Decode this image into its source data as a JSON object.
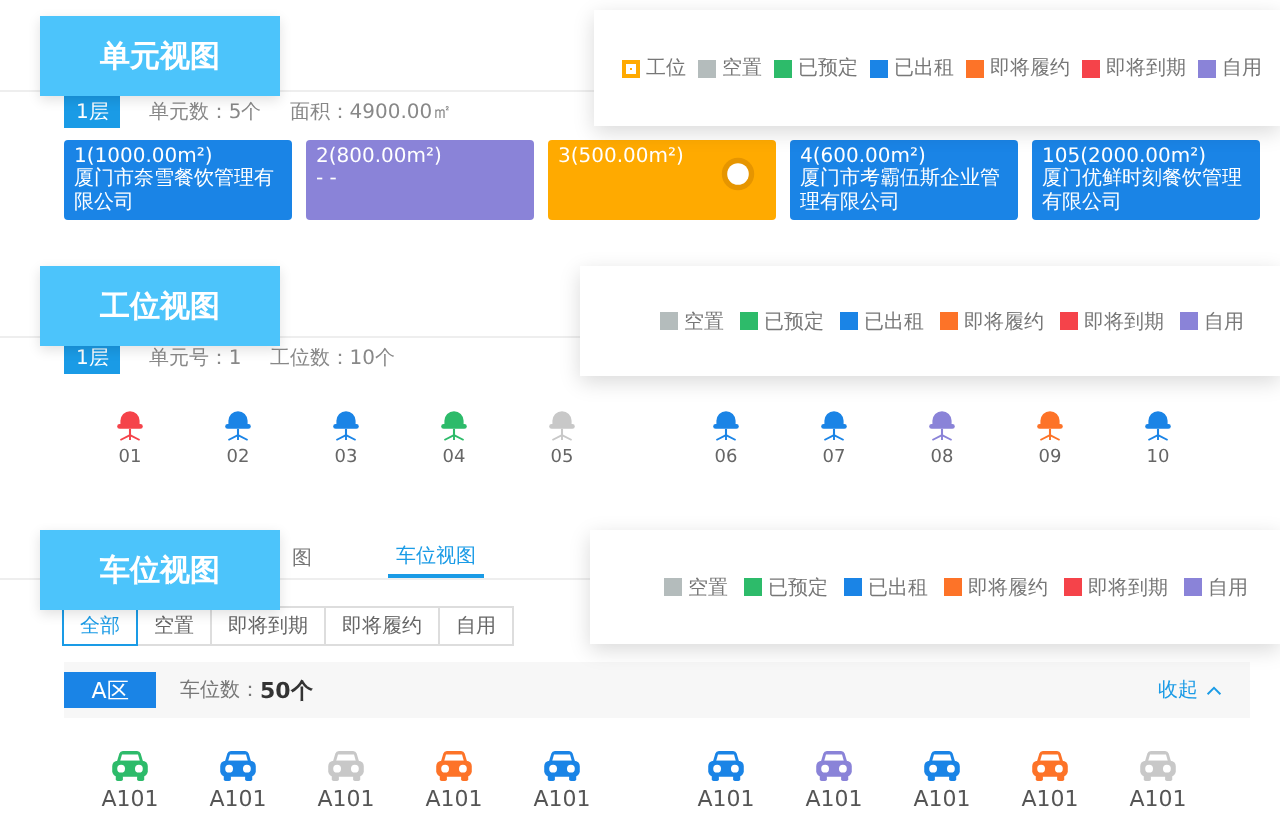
{
  "unit_view": {
    "title": "单元视图",
    "legend": [
      {
        "label": "工位",
        "color": "#ffaa00",
        "kind": "ring"
      },
      {
        "label": "空置",
        "color": "#b4bcbc",
        "kind": "square"
      },
      {
        "label": "已预定",
        "color": "#2dbb6a",
        "kind": "square"
      },
      {
        "label": "已出租",
        "color": "#1a84e6",
        "kind": "square"
      },
      {
        "label": "即将履约",
        "color": "#fd7328",
        "kind": "square"
      },
      {
        "label": "即将到期",
        "color": "#f5434a",
        "kind": "square"
      },
      {
        "label": "自用",
        "color": "#8a83d8",
        "kind": "square"
      }
    ],
    "floor": "1层",
    "unit_count": "单元数：5个",
    "area": "面积：4900.00㎡",
    "units": [
      {
        "name": "1(1000.00m²)",
        "tenant": "厦门市奈雪餐饮管理有限公司",
        "color": "#1a84e6",
        "kind": "unit"
      },
      {
        "name": "2(800.00m²)",
        "tenant": "- -",
        "color": "#8a83d8",
        "kind": "unit"
      },
      {
        "name": "3(500.00m²)",
        "color": "#ffaa00",
        "kind": "workstation"
      },
      {
        "name": "4(600.00m²)",
        "tenant": "厦门市考霸伍斯企业管理有限公司",
        "color": "#1a84e6",
        "kind": "unit"
      },
      {
        "name": "105(2000.00m²)",
        "tenant": "厦门优鲜时刻餐饮管理有限公司",
        "color": "#1a84e6",
        "kind": "unit"
      }
    ]
  },
  "workstation_view": {
    "title": "工位视图",
    "legend": [
      {
        "label": "空置",
        "color": "#b4bcbc"
      },
      {
        "label": "已预定",
        "color": "#2dbb6a"
      },
      {
        "label": "已出租",
        "color": "#1a84e6"
      },
      {
        "label": "即将履约",
        "color": "#fd7328"
      },
      {
        "label": "即将到期",
        "color": "#f5434a"
      },
      {
        "label": "自用",
        "color": "#8a83d8"
      }
    ],
    "floor": "1层",
    "unit_no": "单元号：1",
    "seat_count": "工位数：10个",
    "seats": [
      {
        "label": "01",
        "color": "#f5434a"
      },
      {
        "label": "02",
        "color": "#1a84e6"
      },
      {
        "label": "03",
        "color": "#1a84e6"
      },
      {
        "label": "04",
        "color": "#2dbb6a"
      },
      {
        "label": "05",
        "color": "#c8c8c8"
      },
      {
        "label": "06",
        "color": "#1a84e6"
      },
      {
        "label": "07",
        "color": "#1a84e6"
      },
      {
        "label": "08",
        "color": "#8a83d8"
      },
      {
        "label": "09",
        "color": "#fd7328"
      },
      {
        "label": "10",
        "color": "#1a84e6"
      }
    ]
  },
  "parking_view": {
    "title": "车位视图",
    "tabs": [
      {
        "label": "图",
        "selected": false
      },
      {
        "label": "车位视图",
        "selected": true
      }
    ],
    "legend": [
      {
        "label": "空置",
        "color": "#b4bcbc"
      },
      {
        "label": "已预定",
        "color": "#2dbb6a"
      },
      {
        "label": "已出租",
        "color": "#1a84e6"
      },
      {
        "label": "即将履约",
        "color": "#fd7328"
      },
      {
        "label": "即将到期",
        "color": "#f5434a"
      },
      {
        "label": "自用",
        "color": "#8a83d8"
      }
    ],
    "filters": [
      {
        "label": "全部",
        "selected": true
      },
      {
        "label": "空置",
        "selected": false
      },
      {
        "label": "即将到期",
        "selected": false
      },
      {
        "label": "即将履约",
        "selected": false
      },
      {
        "label": "自用",
        "selected": false
      }
    ],
    "zone": "A区",
    "count_label": "车位数：",
    "count": "50个",
    "collapse": "收起",
    "spaces": [
      {
        "label": "A101",
        "color": "#2dbb6a"
      },
      {
        "label": "A101",
        "color": "#1a84e6"
      },
      {
        "label": "A101",
        "color": "#c8c8c8"
      },
      {
        "label": "A101",
        "color": "#fd7328"
      },
      {
        "label": "A101",
        "color": "#1a84e6"
      },
      {
        "label": "A101",
        "color": "#1a84e6"
      },
      {
        "label": "A101",
        "color": "#8a83d8"
      },
      {
        "label": "A101",
        "color": "#1a84e6"
      },
      {
        "label": "A101",
        "color": "#fd7328"
      },
      {
        "label": "A101",
        "color": "#c8c8c8"
      }
    ]
  }
}
